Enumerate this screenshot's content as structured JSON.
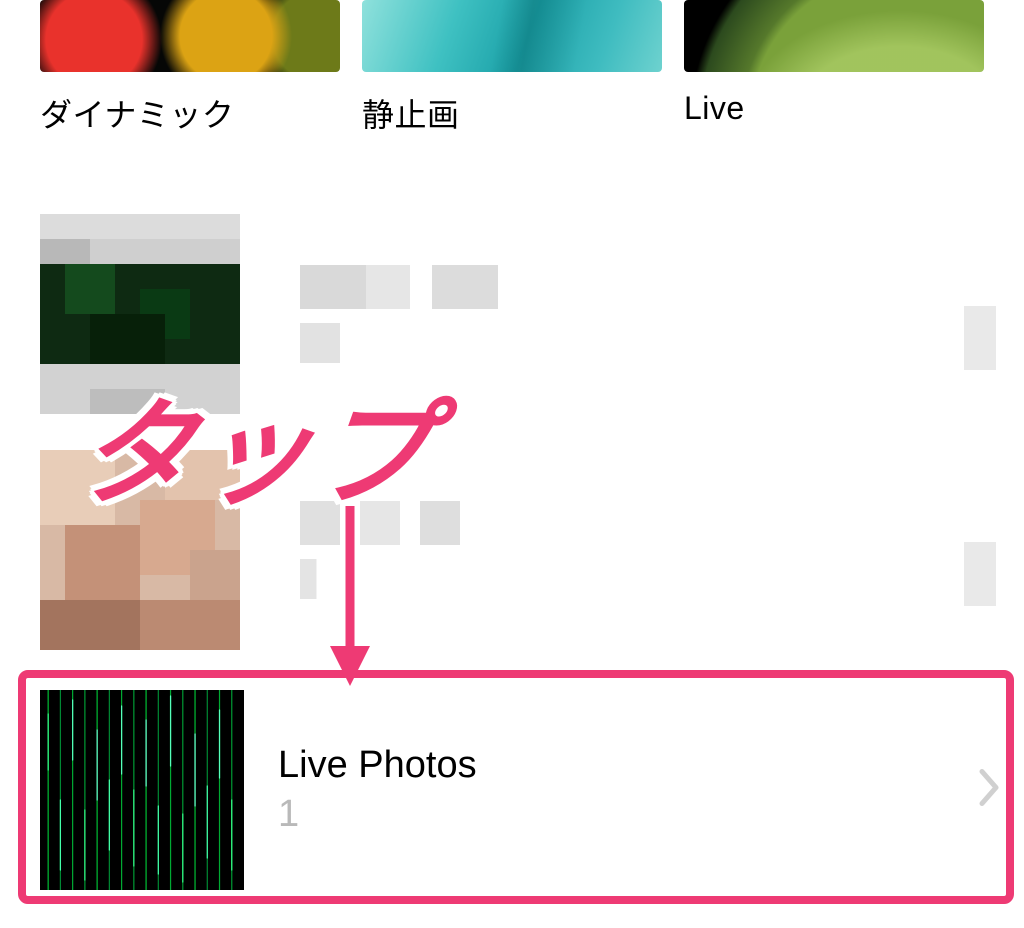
{
  "wallpaper_categories": [
    {
      "label": "ダイナミック"
    },
    {
      "label": "静止画"
    },
    {
      "label": "Live"
    }
  ],
  "albums": {
    "live_photos": {
      "title": "Live Photos",
      "count": "1"
    }
  },
  "annotation": {
    "text": "タップ"
  },
  "colors": {
    "highlight": "#ee3a74"
  }
}
